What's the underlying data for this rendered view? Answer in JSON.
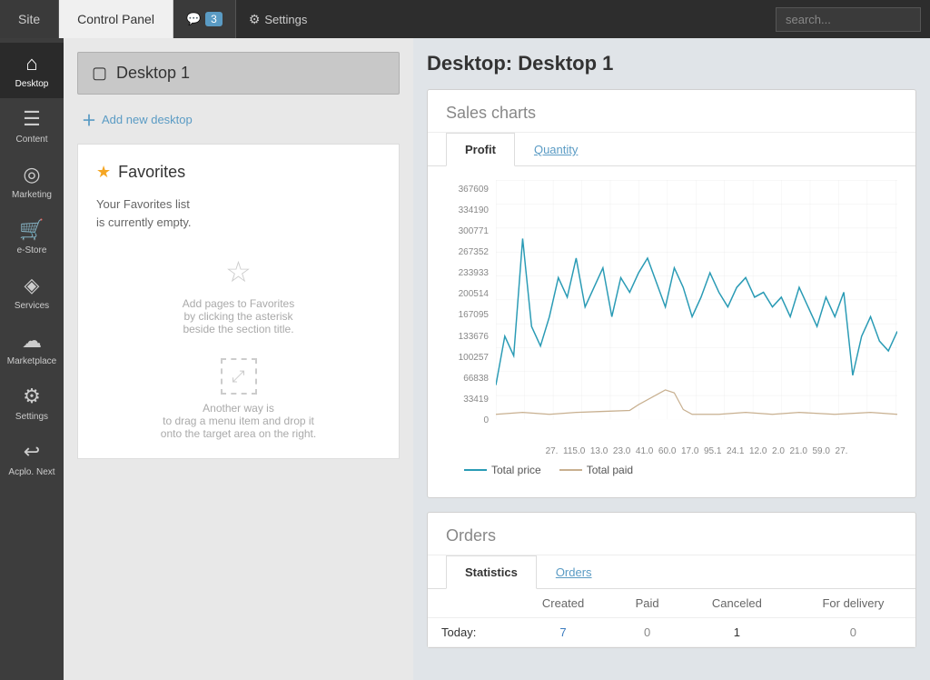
{
  "topNav": {
    "site_label": "Site",
    "control_panel_label": "Control Panel",
    "notifications_count": "3",
    "settings_label": "Settings",
    "search_placeholder": "search..."
  },
  "sidebar": {
    "items": [
      {
        "id": "desktop",
        "label": "Desktop",
        "icon": "⌂",
        "active": true
      },
      {
        "id": "content",
        "label": "Content",
        "icon": "☰"
      },
      {
        "id": "marketing",
        "label": "Marketing",
        "icon": "◎"
      },
      {
        "id": "estore",
        "label": "e-Store",
        "icon": "⛟"
      },
      {
        "id": "services",
        "label": "Services",
        "icon": "◈"
      },
      {
        "id": "marketplace",
        "label": "Marketplace",
        "icon": "☁"
      },
      {
        "id": "settings",
        "label": "Settings",
        "icon": "⚙"
      },
      {
        "id": "acplo-next",
        "label": "Acplo. Next",
        "icon": "↩"
      }
    ]
  },
  "leftPanel": {
    "desktop_name": "Desktop 1",
    "add_new_desktop": "Add new desktop",
    "favorites_title": "Favorites",
    "favorites_star": "★",
    "favorites_empty_line1": "Your Favorites list",
    "favorites_empty_line2": "is currently empty.",
    "favorites_hint1": "Add pages to Favorites",
    "favorites_hint2": "by clicking the asterisk",
    "favorites_hint3": "beside the section title.",
    "favorites_drag1": "Another way is",
    "favorites_drag2": "to drag a menu item and drop it",
    "favorites_drag3": "onto the target area on the right."
  },
  "rightPanel": {
    "main_title": "Desktop: Desktop 1",
    "sales_charts_title": "Sales charts",
    "tab_profit": "Profit",
    "tab_quantity": "Quantity",
    "chart_y_labels": [
      "367609",
      "334190",
      "300771",
      "267352",
      "233933",
      "200514",
      "167095",
      "133676",
      "100257",
      "66838",
      "33419",
      "0"
    ],
    "chart_x_labels": "27.11. 5.0. 13.0. 23.0. 41.0. 60.0. 17.0. 95.1. 24.1. 12.0. 2.0. 21.0. 59.0. 27.",
    "legend_total_price": "Total price",
    "legend_total_paid": "Total paid",
    "orders_title": "Orders",
    "tab_statistics": "Statistics",
    "tab_orders": "Orders",
    "table_headers": {
      "col1": "",
      "created": "Created",
      "paid": "Paid",
      "canceled": "Canceled",
      "for_delivery": "For delivery"
    },
    "table_rows": [
      {
        "label": "Today:",
        "created": "7",
        "paid": "0",
        "canceled": "1",
        "for_delivery": "0"
      }
    ]
  }
}
